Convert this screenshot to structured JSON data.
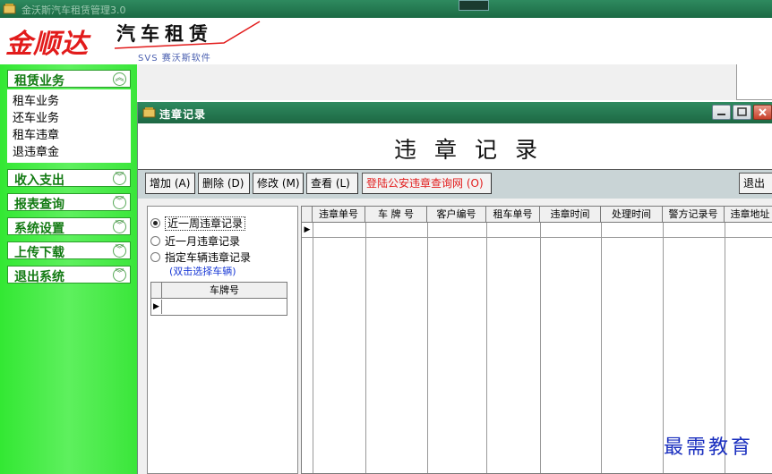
{
  "app": {
    "title": "金沃斯汽车租赁管理3.0"
  },
  "header": {
    "logo_text": "金顺达",
    "logo_sub": "汽车租赁",
    "logo_tagline": "SVS 赛沃斯软件"
  },
  "sidebar": {
    "menus": [
      {
        "label": "租赁业务",
        "expanded": true,
        "icon": "chevron-up-icon",
        "items": [
          "租车业务",
          "还车业务",
          "租车违章",
          "退违章金"
        ]
      },
      {
        "label": "收入支出",
        "icon": "chevron-down-icon"
      },
      {
        "label": "报表查询",
        "icon": "chevron-down-icon"
      },
      {
        "label": "系统设置",
        "icon": "chevron-down-icon"
      },
      {
        "label": "上传下载",
        "icon": "chevron-down-icon"
      },
      {
        "label": "退出系统",
        "icon": "chevron-down-icon"
      }
    ]
  },
  "window": {
    "title": "违章记录",
    "heading": "违章记录",
    "toolbar": {
      "add": "增加 (A)",
      "delete": "删除 (D)",
      "edit": "修改 (M)",
      "view": "查看 (L)",
      "login_police": "登陆公安违章查询网 (O)",
      "exit": "退出"
    },
    "filters": {
      "options": [
        "近一周违章记录",
        "近一月违章记录",
        "指定车辆违章记录"
      ],
      "selected": 0,
      "hint": "(双击选择车辆)",
      "plate_column": "车牌号"
    },
    "grid": {
      "columns": [
        "违章单号",
        "车 牌 号",
        "客户编号",
        "租车单号",
        "违章时间",
        "处理时间",
        "警方记录号",
        "违章地址"
      ]
    }
  },
  "watermark": "最需教育",
  "colors": {
    "sidebar_green": "#3ae63a",
    "title_green": "#1d6843",
    "link_red": "#e21b1b",
    "hint_blue": "#1a3ad6"
  }
}
